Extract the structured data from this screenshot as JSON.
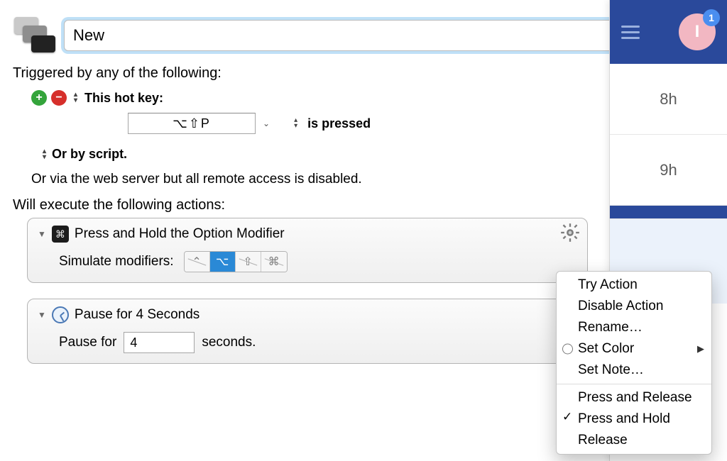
{
  "macro": {
    "name": "New",
    "enabled": true
  },
  "triggers": {
    "heading": "Triggered by any of the following:",
    "hotkey_label": "This hot key:",
    "hotkey_value": "⌥⇧P",
    "state_label": "is pressed",
    "script_label": "Or by script.",
    "remote_label": "Or via the web server but all remote access is disabled."
  },
  "actions_heading": "Will execute the following actions:",
  "action1": {
    "title": "Press and Hold the Option Modifier",
    "modifiers_label": "Simulate modifiers:",
    "mods": {
      "ctrl": false,
      "opt": true,
      "shift": false,
      "cmd": false
    }
  },
  "action2": {
    "title": "Pause for 4 Seconds",
    "pause_prefix": "Pause for",
    "pause_value": "4",
    "pause_suffix": "seconds."
  },
  "context_menu": {
    "try": "Try Action",
    "disable": "Disable Action",
    "rename": "Rename…",
    "color": "Set Color",
    "note": "Set Note…",
    "press_release": "Press and Release",
    "press_hold": "Press and Hold",
    "release": "Release",
    "selected": "press_hold"
  },
  "right_app": {
    "avatar_initial": "I",
    "badge": "1",
    "hours": [
      "8h",
      "9h"
    ]
  }
}
